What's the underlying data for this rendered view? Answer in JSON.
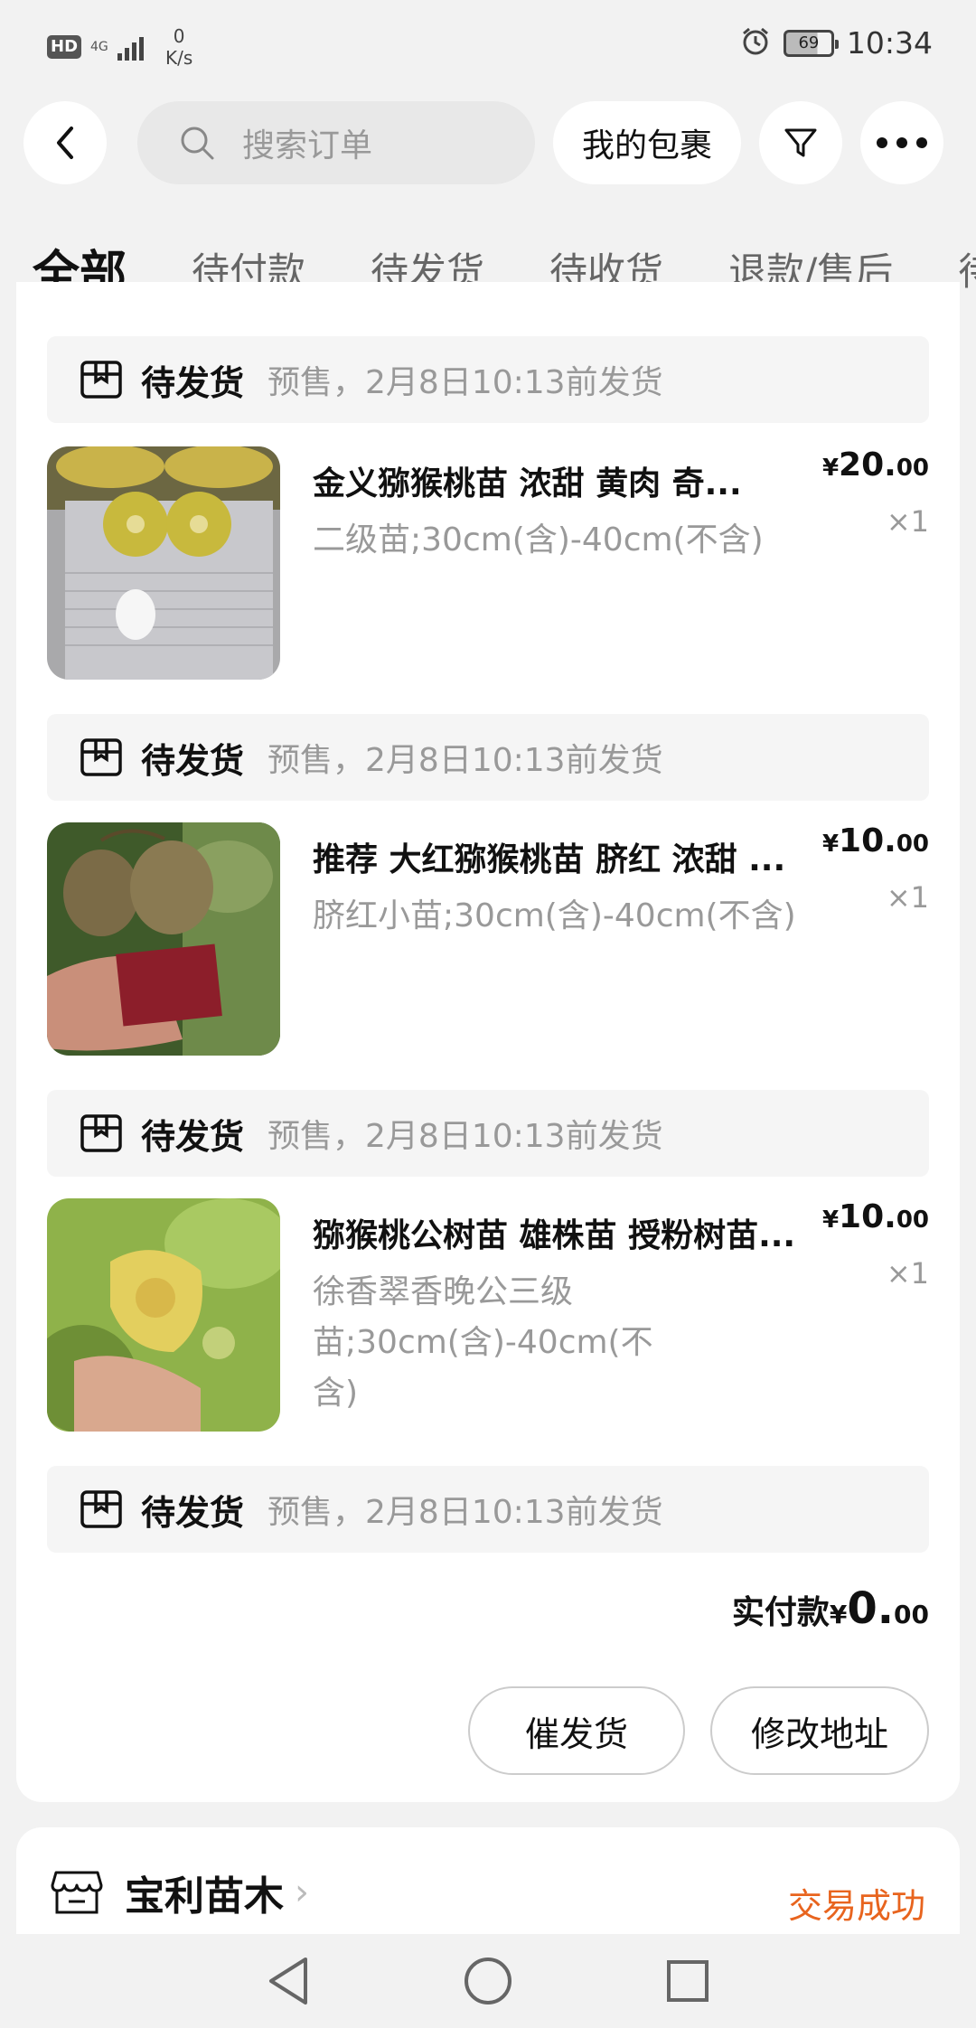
{
  "status_bar": {
    "hd": "HD",
    "network": "4G",
    "speed_value": "0",
    "speed_unit": "K/s",
    "battery": "69",
    "time": "10:34"
  },
  "top_nav": {
    "search_placeholder": "搜索订单",
    "package_label": "我的包裹"
  },
  "tabs": [
    "全部",
    "待付款",
    "待发货",
    "待收货",
    "退款/售后",
    "待"
  ],
  "orders": [
    {
      "status": "待发货",
      "note": "预售，2月8日10:13前发货",
      "title": "金义猕猴桃苗 浓甜  黄肉  奇...",
      "spec": "二级苗;30cm(含)-40cm(不含)",
      "price_currency": "¥",
      "price_int": "20.",
      "price_dec": "00",
      "qty": "×1"
    },
    {
      "status": "待发货",
      "note": "预售，2月8日10:13前发货",
      "title": "推荐 大红猕猴桃苗  脐红 浓甜 ...",
      "spec": "脐红小苗;30cm(含)-40cm(不含)",
      "price_currency": "¥",
      "price_int": "10.",
      "price_dec": "00",
      "qty": "×1"
    },
    {
      "status": "待发货",
      "note": "预售，2月8日10:13前发货",
      "title": "猕猴桃公树苗 雄株苗 授粉树苗...",
      "spec": "徐香翠香晚公三级苗;30cm(含)-40cm(不含)",
      "price_currency": "¥",
      "price_int": "10.",
      "price_dec": "00",
      "qty": "×1"
    }
  ],
  "footer_status": {
    "status": "待发货",
    "note": "预售，2月8日10:13前发货"
  },
  "total": {
    "label": "实付款",
    "currency": "¥",
    "int": "0.",
    "dec": "00"
  },
  "actions": {
    "urge_label": "催发货",
    "address_label": "修改地址"
  },
  "store": {
    "name": "宝利苗木",
    "chevron": "›",
    "deal_status": "交易成功"
  },
  "colors": {
    "accent_orange": "#e8641e",
    "background": "#f2f2f2"
  }
}
